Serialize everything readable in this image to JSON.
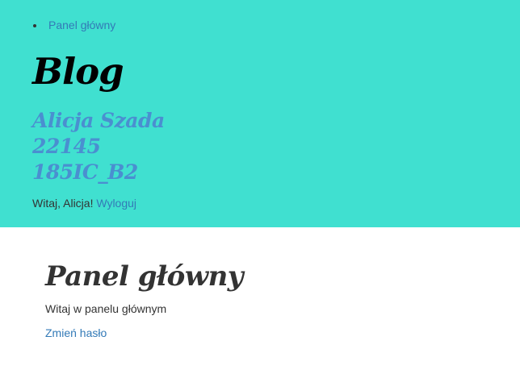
{
  "colors": {
    "header_background": "#40e0d0",
    "link": "#337ab7",
    "user_info": "#4a8fd0",
    "text": "#333333"
  },
  "nav": {
    "items": [
      {
        "label": "Panel główny"
      }
    ]
  },
  "header": {
    "title": "Blog",
    "user": {
      "name": "Alicja Szada",
      "id": "22145",
      "group": "185IC_B2"
    },
    "greeting": {
      "text": "Witaj, Alicja!",
      "logout_label": "Wyloguj"
    }
  },
  "main": {
    "title": "Panel główny",
    "welcome": "Witaj w panelu głównym",
    "change_password_label": "Zmień hasło"
  }
}
